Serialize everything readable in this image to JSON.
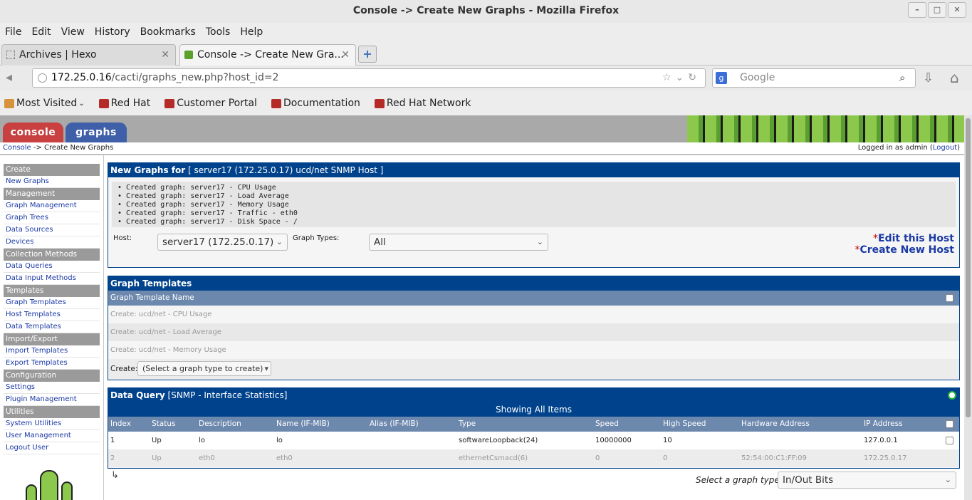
{
  "window": {
    "title": "Console -> Create New Graphs - Mozilla Firefox"
  },
  "menubar": [
    "File",
    "Edit",
    "View",
    "History",
    "Bookmarks",
    "Tools",
    "Help"
  ],
  "tabs": [
    {
      "label": "Archives | Hexo",
      "close": "✕"
    },
    {
      "label": "Console -> Create New Gra...",
      "close": "✕"
    }
  ],
  "newtab_label": "+",
  "url": {
    "host": "172.25.0.16",
    "path": "/cacti/graphs_new.php?host_id=2"
  },
  "search": {
    "placeholder": "Google",
    "engine_letter": "g"
  },
  "bookmarks": [
    "Most Visited",
    "Red Hat",
    "Customer Portal",
    "Documentation",
    "Red Hat Network"
  ],
  "cacti": {
    "tabs": {
      "console": "console",
      "graphs": "graphs"
    },
    "breadcrumb": {
      "link": "Console",
      "rest": " -> Create New Graphs"
    },
    "login": {
      "prefix": "Logged in as admin (",
      "link": "Logout",
      "suffix": ")"
    }
  },
  "sidebar": [
    {
      "type": "head",
      "label": "Create"
    },
    {
      "type": "item",
      "label": "New Graphs"
    },
    {
      "type": "head",
      "label": "Management"
    },
    {
      "type": "item",
      "label": "Graph Management"
    },
    {
      "type": "item",
      "label": "Graph Trees"
    },
    {
      "type": "item",
      "label": "Data Sources"
    },
    {
      "type": "item",
      "label": "Devices"
    },
    {
      "type": "head",
      "label": "Collection Methods"
    },
    {
      "type": "item",
      "label": "Data Queries"
    },
    {
      "type": "item",
      "label": "Data Input Methods"
    },
    {
      "type": "head",
      "label": "Templates"
    },
    {
      "type": "item",
      "label": "Graph Templates"
    },
    {
      "type": "item",
      "label": "Host Templates"
    },
    {
      "type": "item",
      "label": "Data Templates"
    },
    {
      "type": "head",
      "label": "Import/Export"
    },
    {
      "type": "item",
      "label": "Import Templates"
    },
    {
      "type": "item",
      "label": "Export Templates"
    },
    {
      "type": "head",
      "label": "Configuration"
    },
    {
      "type": "item",
      "label": "Settings"
    },
    {
      "type": "item",
      "label": "Plugin Management"
    },
    {
      "type": "head",
      "label": "Utilities"
    },
    {
      "type": "item",
      "label": "System Utilities"
    },
    {
      "type": "item",
      "label": "User Management"
    },
    {
      "type": "item",
      "label": "Logout User"
    }
  ],
  "new_graphs": {
    "title_bold": "New Graphs for",
    "title_rest": " [ server17 (172.25.0.17) ucd/net SNMP Host ]",
    "results": [
      "• Created graph: server17 - CPU Usage",
      "• Created graph: server17 - Load Average",
      "• Created graph: server17 - Memory Usage",
      "• Created graph: server17 - Traffic - eth0",
      "• Created graph: server17 - Disk Space - /"
    ],
    "host_label": "Host:",
    "host_value": "server17 (172.25.0.17)",
    "graph_types_label": "Graph Types:",
    "graph_types_value": "All",
    "edit_host": "Edit this Host",
    "create_host": "Create New Host",
    "star": "*"
  },
  "graph_templates": {
    "title": "Graph Templates",
    "column": "Graph Template Name",
    "rows": [
      "Create: ucd/net - CPU Usage",
      "Create: ucd/net - Load Average",
      "Create: ucd/net - Memory Usage"
    ],
    "create_label": "Create:",
    "create_select": "(Select a graph type to create)"
  },
  "data_query": {
    "title_bold": "Data Query",
    "title_rest": " [SNMP - Interface Statistics]",
    "showing": "Showing All Items",
    "columns": [
      "Index",
      "Status",
      "Description",
      "Name (IF-MIB)",
      "Alias (IF-MIB)",
      "Type",
      "Speed",
      "High Speed",
      "Hardware Address",
      "IP Address"
    ],
    "rows": [
      [
        "1",
        "Up",
        "lo",
        "lo",
        "",
        "softwareLoopback(24)",
        "10000000",
        "10",
        "",
        "127.0.0.1"
      ],
      [
        "2",
        "Up",
        "eth0",
        "eth0",
        "",
        "ethernetCsmacd(6)",
        "0",
        "0",
        "52:54:00:C1:FF:09",
        "172.25.0.17"
      ]
    ],
    "select_label": "Select a graph type:",
    "select_value": "In/Out Bits",
    "return_glyph": "↳"
  }
}
